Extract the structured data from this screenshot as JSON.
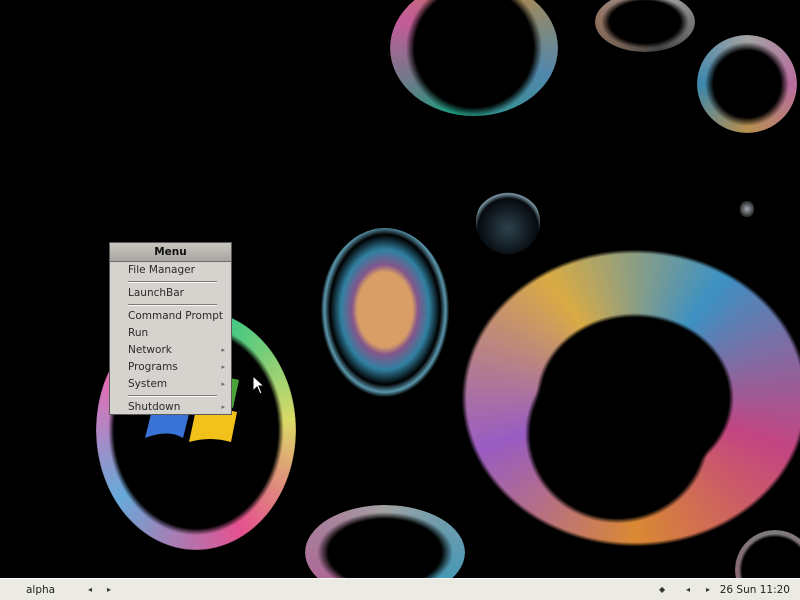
{
  "menu": {
    "title": "Menu",
    "items": [
      {
        "label": "File Manager",
        "submenu": false
      },
      {
        "label": "LaunchBar",
        "submenu": false
      },
      {
        "label": "Command Prompt",
        "submenu": false
      },
      {
        "label": "Run",
        "submenu": false
      },
      {
        "label": "Network",
        "submenu": true
      },
      {
        "label": "Programs",
        "submenu": true
      },
      {
        "label": "System",
        "submenu": true
      },
      {
        "label": "Shutdown",
        "submenu": true
      }
    ],
    "submenu_arrow": "▸"
  },
  "taskbar": {
    "workspace_name": "alpha",
    "prev_workspace_icon": "◂",
    "next_workspace_icon": "▸",
    "tray_icon": "◆",
    "prev_window_icon": "◂",
    "next_window_icon": "▸",
    "clock": "26 Sun 11:20"
  },
  "colors": {
    "desktop_background": "#000000",
    "menu_background": "#d6d3ce",
    "taskbar_background": "#ebebe3"
  },
  "icons": {
    "desktop_logo": "windows-logo-icon",
    "cursor": "mouse-pointer-icon"
  }
}
